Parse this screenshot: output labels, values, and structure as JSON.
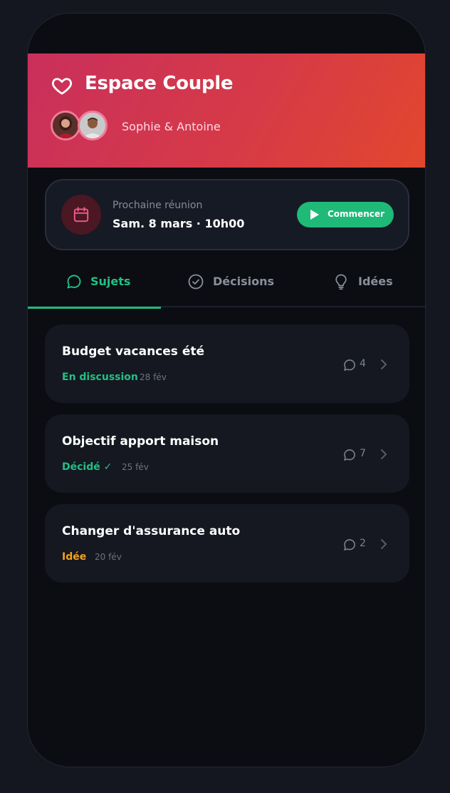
{
  "header": {
    "title": "Espace Couple",
    "partners": "Sophie & Antoine",
    "gradient": [
      "#c92f5c",
      "#e2472d"
    ]
  },
  "meeting": {
    "label": "Prochaine réunion",
    "date": "Sam. 8 mars · 10h00",
    "button_label": "Commencer",
    "accent": "#1fb978"
  },
  "tabs": [
    {
      "label": "Sujets",
      "icon": "chat-bubble-icon",
      "active": true
    },
    {
      "label": "Décisions",
      "icon": "check-circle-icon",
      "active": false
    },
    {
      "label": "Idées",
      "icon": "lightbulb-icon",
      "active": false
    }
  ],
  "topics": [
    {
      "title": "Budget vacances été",
      "status": "En discussion",
      "status_color": "#22c082",
      "date": "28 fév",
      "comments": "4"
    },
    {
      "title": "Objectif apport maison",
      "status": "Décidé ✓",
      "status_color": "#22c082",
      "date": "25 fév",
      "comments": "7"
    },
    {
      "title": "Changer d'assurance auto",
      "status": "Idée",
      "status_color": "#f5a21e",
      "date": "20 fév",
      "comments": "2"
    }
  ]
}
